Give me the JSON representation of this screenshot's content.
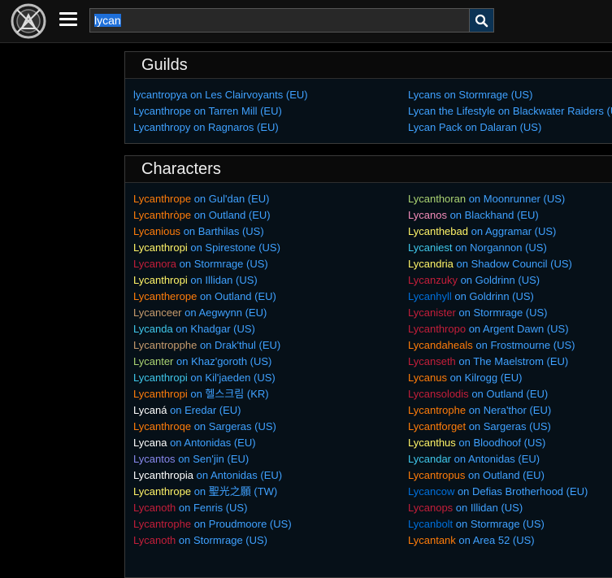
{
  "search": {
    "value": "lycan"
  },
  "icons": {
    "logo": "site-logo",
    "menu": "hamburger-icon",
    "search": "search-icon"
  },
  "colors": {
    "link": "#3fa1ff",
    "warrior": "#c69b6d",
    "paladin": "#f48cba",
    "hunter": "#aad372",
    "rogue": "#fff468",
    "priest": "#ffffff",
    "deathknight": "#c41e3a",
    "shaman": "#0070dd",
    "mage": "#3fc7eb",
    "warlock": "#8788ee",
    "monk": "#00ff98",
    "druid": "#ff7c0a",
    "demonhunter": "#a330c9",
    "evoker": "#33937f"
  },
  "guilds": {
    "title": "Guilds",
    "left": [
      {
        "name": "lycantropya",
        "realm": "on Les Clairvoyants (EU)"
      },
      {
        "name": "Lycanthrope",
        "realm": "on Tarren Mill (EU)"
      },
      {
        "name": "Lycanthropy",
        "realm": "on Ragnaros (EU)"
      }
    ],
    "right": [
      {
        "name": "Lycans",
        "realm": "on Stormrage (US)"
      },
      {
        "name": "Lycan the Lifestyle",
        "realm": "on Blackwater Raiders (US)"
      },
      {
        "name": "Lycan Pack",
        "realm": "on Dalaran (US)"
      }
    ]
  },
  "characters": {
    "title": "Characters",
    "left": [
      {
        "name": "Lycanthrope",
        "realm": "on Gul'dan (EU)",
        "color": "#ff7c0a"
      },
      {
        "name": "Lycanthròpe",
        "realm": "on Outland (EU)",
        "color": "#ff7c0a"
      },
      {
        "name": "Lycanious",
        "realm": "on Barthilas (US)",
        "color": "#ff7c0a"
      },
      {
        "name": "Lycanthropi",
        "realm": "on Spirestone (US)",
        "color": "#fff468"
      },
      {
        "name": "Lycanora",
        "realm": "on Stormrage (US)",
        "color": "#c41e3a"
      },
      {
        "name": "Lycanthropi",
        "realm": "on Illidan (US)",
        "color": "#fff468"
      },
      {
        "name": "Lycantherope",
        "realm": "on Outland (EU)",
        "color": "#ff7c0a"
      },
      {
        "name": "Lycanceer",
        "realm": "on Aegwynn (EU)",
        "color": "#c69b6d"
      },
      {
        "name": "Lycanda",
        "realm": "on Khadgar (US)",
        "color": "#3fc7eb"
      },
      {
        "name": "Lycantropphe",
        "realm": "on Drak'thul (EU)",
        "color": "#c69b6d"
      },
      {
        "name": "Lycanter",
        "realm": "on Khaz'goroth (US)",
        "color": "#aad372"
      },
      {
        "name": "Lycanthropi",
        "realm": "on Kil'jaeden (US)",
        "color": "#3fc7eb"
      },
      {
        "name": "Lycanthropi",
        "realm": "on 헬스크림 (KR)",
        "color": "#ff7c0a"
      },
      {
        "name": "Lycaná",
        "realm": "on Eredar (EU)",
        "color": "#ffffff"
      },
      {
        "name": "Lycanthroqe",
        "realm": "on Sargeras (US)",
        "color": "#ff7c0a"
      },
      {
        "name": "Lycana",
        "realm": "on Antonidas (EU)",
        "color": "#ffffff"
      },
      {
        "name": "Lycantos",
        "realm": "on Sen'jin (EU)",
        "color": "#8788ee"
      },
      {
        "name": "Lycanthropia",
        "realm": "on Antonidas (EU)",
        "color": "#ffffff"
      },
      {
        "name": "Lycanthrope",
        "realm": "on 聖光之願 (TW)",
        "color": "#fff468"
      },
      {
        "name": "Lycanoth",
        "realm": "on Fenris (US)",
        "color": "#c41e3a"
      },
      {
        "name": "Lycantrophe",
        "realm": "on Proudmoore (US)",
        "color": "#c41e3a"
      },
      {
        "name": "Lycanoth",
        "realm": "on Stormrage (US)",
        "color": "#c41e3a"
      }
    ],
    "right": [
      {
        "name": "Lycanthoran",
        "realm": "on Moonrunner (US)",
        "color": "#aad372"
      },
      {
        "name": "Lycanos",
        "realm": "on Blackhand (EU)",
        "color": "#f48cba"
      },
      {
        "name": "Lycanthebad",
        "realm": "on Aggramar (US)",
        "color": "#fff468"
      },
      {
        "name": "Lycaniest",
        "realm": "on Norgannon (US)",
        "color": "#3fc7eb"
      },
      {
        "name": "Lycandria",
        "realm": "on Shadow Council (US)",
        "color": "#fff468"
      },
      {
        "name": "Lycanzuky",
        "realm": "on Goldrinn (US)",
        "color": "#c41e3a"
      },
      {
        "name": "Lycanhyll",
        "realm": "on Goldrinn (US)",
        "color": "#0070dd"
      },
      {
        "name": "Lycanister",
        "realm": "on Stormrage (US)",
        "color": "#c41e3a"
      },
      {
        "name": "Lycanthropo",
        "realm": "on Argent Dawn (US)",
        "color": "#c41e3a"
      },
      {
        "name": "Lycandaheals",
        "realm": "on Frostmourne (US)",
        "color": "#ff7c0a"
      },
      {
        "name": "Lycanseth",
        "realm": "on The Maelstrom (EU)",
        "color": "#c41e3a"
      },
      {
        "name": "Lycanus",
        "realm": "on Kilrogg (EU)",
        "color": "#ff7c0a"
      },
      {
        "name": "Lycansolodis",
        "realm": "on Outland (EU)",
        "color": "#c41e3a"
      },
      {
        "name": "Lycantrophe",
        "realm": "on Nera'thor (EU)",
        "color": "#ff7c0a"
      },
      {
        "name": "Lycantforget",
        "realm": "on Sargeras (US)",
        "color": "#ff7c0a"
      },
      {
        "name": "Lycanthus",
        "realm": "on Bloodhoof (US)",
        "color": "#fff468"
      },
      {
        "name": "Lycandar",
        "realm": "on Antonidas (EU)",
        "color": "#3fc7eb"
      },
      {
        "name": "Lycantropus",
        "realm": "on Outland (EU)",
        "color": "#ff7c0a"
      },
      {
        "name": "Lycancow",
        "realm": "on Defias Brotherhood (EU)",
        "color": "#0070dd"
      },
      {
        "name": "Lycanops",
        "realm": "on Illidan (US)",
        "color": "#c41e3a"
      },
      {
        "name": "Lycanbolt",
        "realm": "on Stormrage (US)",
        "color": "#0070dd"
      },
      {
        "name": "Lycantank",
        "realm": "on Area 52 (US)",
        "color": "#ff7c0a"
      }
    ]
  }
}
